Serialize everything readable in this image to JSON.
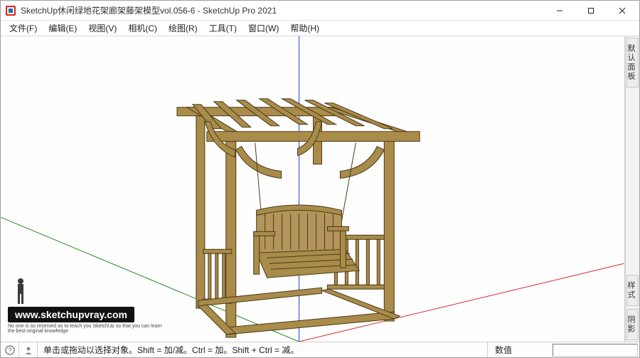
{
  "window": {
    "title": "SketchUp休闲绿地花架廊架藤架模型vol.056-6 - SketchUp Pro 2021"
  },
  "menu": {
    "file": "文件(F)",
    "edit": "编辑(E)",
    "view": "视图(V)",
    "camera": "相机(C)",
    "draw": "绘图(R)",
    "tools": "工具(T)",
    "window": "窗口(W)",
    "help": "帮助(H)"
  },
  "trays": {
    "default_tray": "默认面板",
    "styles": "样式",
    "shadows": "阴影"
  },
  "watermark": {
    "banner": "www.sketchupvray.com",
    "sub": "No one is so reserved as to teach you SketchUp so that you can learn the best original knowledge"
  },
  "status": {
    "hint": "单击或拖动以选择对象。Shift = 加/减。Ctrl = 加。Shift + Ctrl = 减。",
    "measure_label": "数值"
  },
  "colors": {
    "axis_x": "#d42c2c",
    "axis_y": "#1f8a1f",
    "axis_z": "#1f3fd4",
    "wood_fill": "#a98b4a",
    "wood_edge": "#4a3b18"
  }
}
